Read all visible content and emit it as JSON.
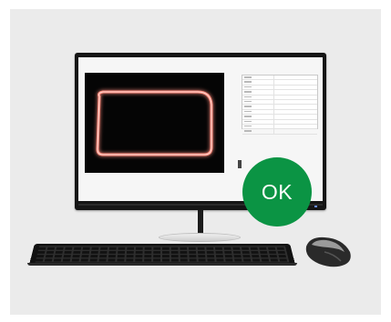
{
  "status": {
    "ok_label": "OK",
    "ok_color": "#0b9444"
  },
  "colors": {
    "panel_background": "#ebebeb",
    "camera_outline": "#ff8c7e",
    "screen_background": "#f6f6f6"
  },
  "icons": {
    "monitor": "monitor-icon",
    "keyboard": "keyboard-icon",
    "mouse": "mouse-icon"
  }
}
